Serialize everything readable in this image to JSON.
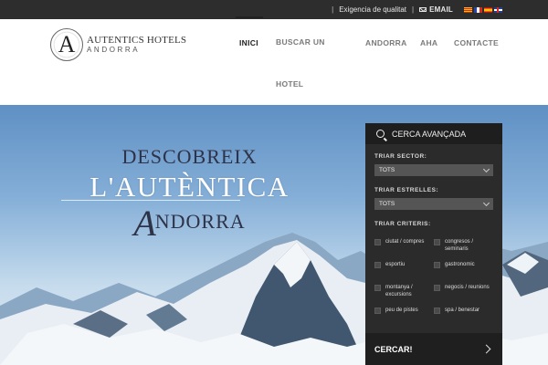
{
  "topbar": {
    "quality_link": "Exigencia de qualitat",
    "email_label": "EMAIL",
    "languages": [
      "ca",
      "fr",
      "es",
      "en"
    ]
  },
  "brand": {
    "name_line1": "AUTENTICS HOTELS",
    "name_line2": "ANDORRA",
    "mark_letter": "A"
  },
  "nav": {
    "items": [
      {
        "label": "INICI",
        "active": true
      },
      {
        "label": "BUSCAR UN HOTEL",
        "active": false
      },
      {
        "label": "ANDORRA",
        "active": false
      },
      {
        "label": "AHA",
        "active": false
      },
      {
        "label": "CONTACTE",
        "active": false
      }
    ]
  },
  "hero": {
    "line1": "DESCOBREIX",
    "line2": "L'AUTÈNTICA",
    "line3_initial": "A",
    "line3_rest": "NDORRA"
  },
  "search": {
    "title": "CERCA AVANÇADA",
    "sector_label": "TRIAR SECTOR:",
    "sector_value": "TOTS",
    "stars_label": "TRIAR ESTRELLES:",
    "stars_value": "TOTS",
    "criteria_label": "TRIAR CRITERIS:",
    "criteria": [
      "ciutat / compres",
      "congresos / seminaris",
      "esportiu",
      "gastronomic",
      "montanya / excursions",
      "negocis / reunions",
      "peu de pistes",
      "spa / benestar"
    ],
    "submit_label": "CERCAR!"
  },
  "colors": {
    "topbar_bg": "#2d2d2d",
    "panel_bg": "#2b2b2b",
    "title_dark": "#2e3348"
  }
}
